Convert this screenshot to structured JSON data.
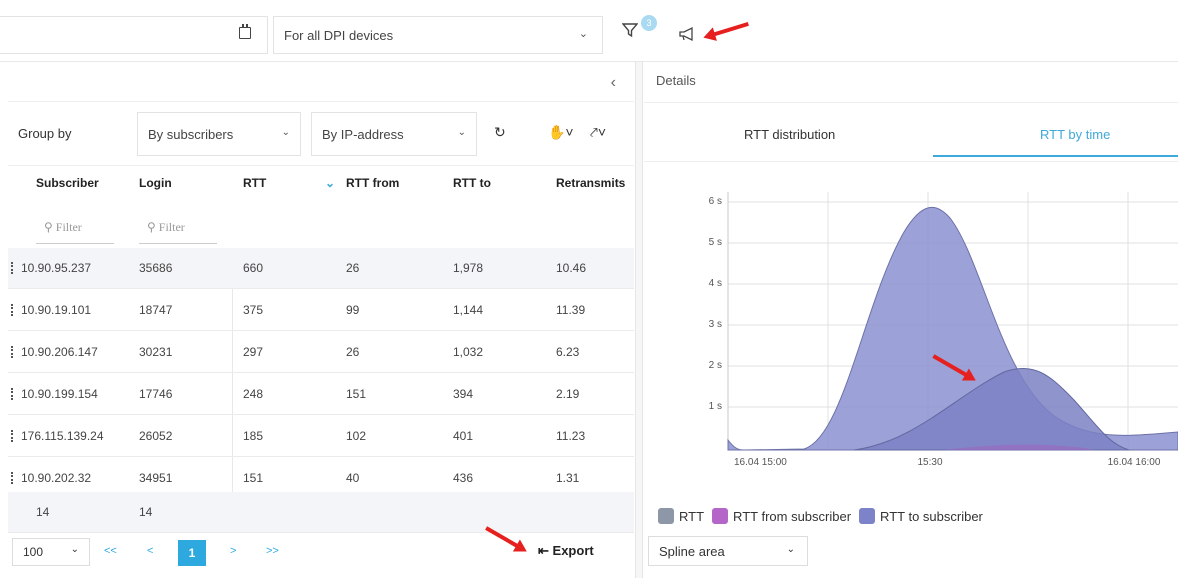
{
  "toolbar": {
    "dpi_select": "For all DPI devices",
    "filter_count": "3"
  },
  "table": {
    "group_by_label": "Group by",
    "group_select_1": "By subscribers",
    "group_select_2": "By IP-address",
    "columns": [
      "Subscriber",
      "Login",
      "RTT",
      "RTT from",
      "RTT to",
      "Retransmits"
    ],
    "filter_placeholder": "Filter",
    "rows": [
      [
        "10.90.95.237",
        "35686",
        "660",
        "26",
        "1,978",
        "10.46"
      ],
      [
        "10.90.19.101",
        "18747",
        "375",
        "99",
        "1,144",
        "11.39"
      ],
      [
        "10.90.206.147",
        "30231",
        "297",
        "26",
        "1,032",
        "6.23"
      ],
      [
        "10.90.199.154",
        "17746",
        "248",
        "151",
        "394",
        "2.19"
      ],
      [
        "176.115.139.24",
        "26052",
        "185",
        "102",
        "401",
        "11.23"
      ],
      [
        "10.90.202.32",
        "34951",
        "151",
        "40",
        "436",
        "1.31"
      ]
    ],
    "totals": [
      "14",
      "14"
    ]
  },
  "pager": {
    "page_size": "100",
    "first": "<<",
    "prev": "<",
    "current": "1",
    "next": ">",
    "last": ">>",
    "export_label": "Export"
  },
  "details": {
    "title": "Details",
    "tabs": [
      "RTT distribution",
      "RTT by time"
    ],
    "active_tab": "RTT by time",
    "chart_type_select": "Spline area"
  },
  "chart_data": {
    "type": "area",
    "x_ticks": [
      "16.04 15:00",
      "15:30",
      "16.04 16:00"
    ],
    "y_ticks": [
      "1 s",
      "2 s",
      "3 s",
      "4 s",
      "5 s",
      "6 s"
    ],
    "ylim": [
      0,
      6
    ],
    "grid": true,
    "legend_position": "bottom-left",
    "series": [
      {
        "name": "RTT",
        "color": "#8e97a8"
      },
      {
        "name": "RTT from subscriber",
        "color": "#b565c8",
        "peak_s": 0.1
      },
      {
        "name": "RTT to subscriber",
        "color": "#7c83c9",
        "peak_s": 5.9
      }
    ],
    "second_hump_peak_s": 1.95
  },
  "colors": {
    "accent": "#2ea9e0",
    "arrow": "#e5201f",
    "area_primary": "#8b90d0",
    "area_secondary": "#7b81c4"
  }
}
